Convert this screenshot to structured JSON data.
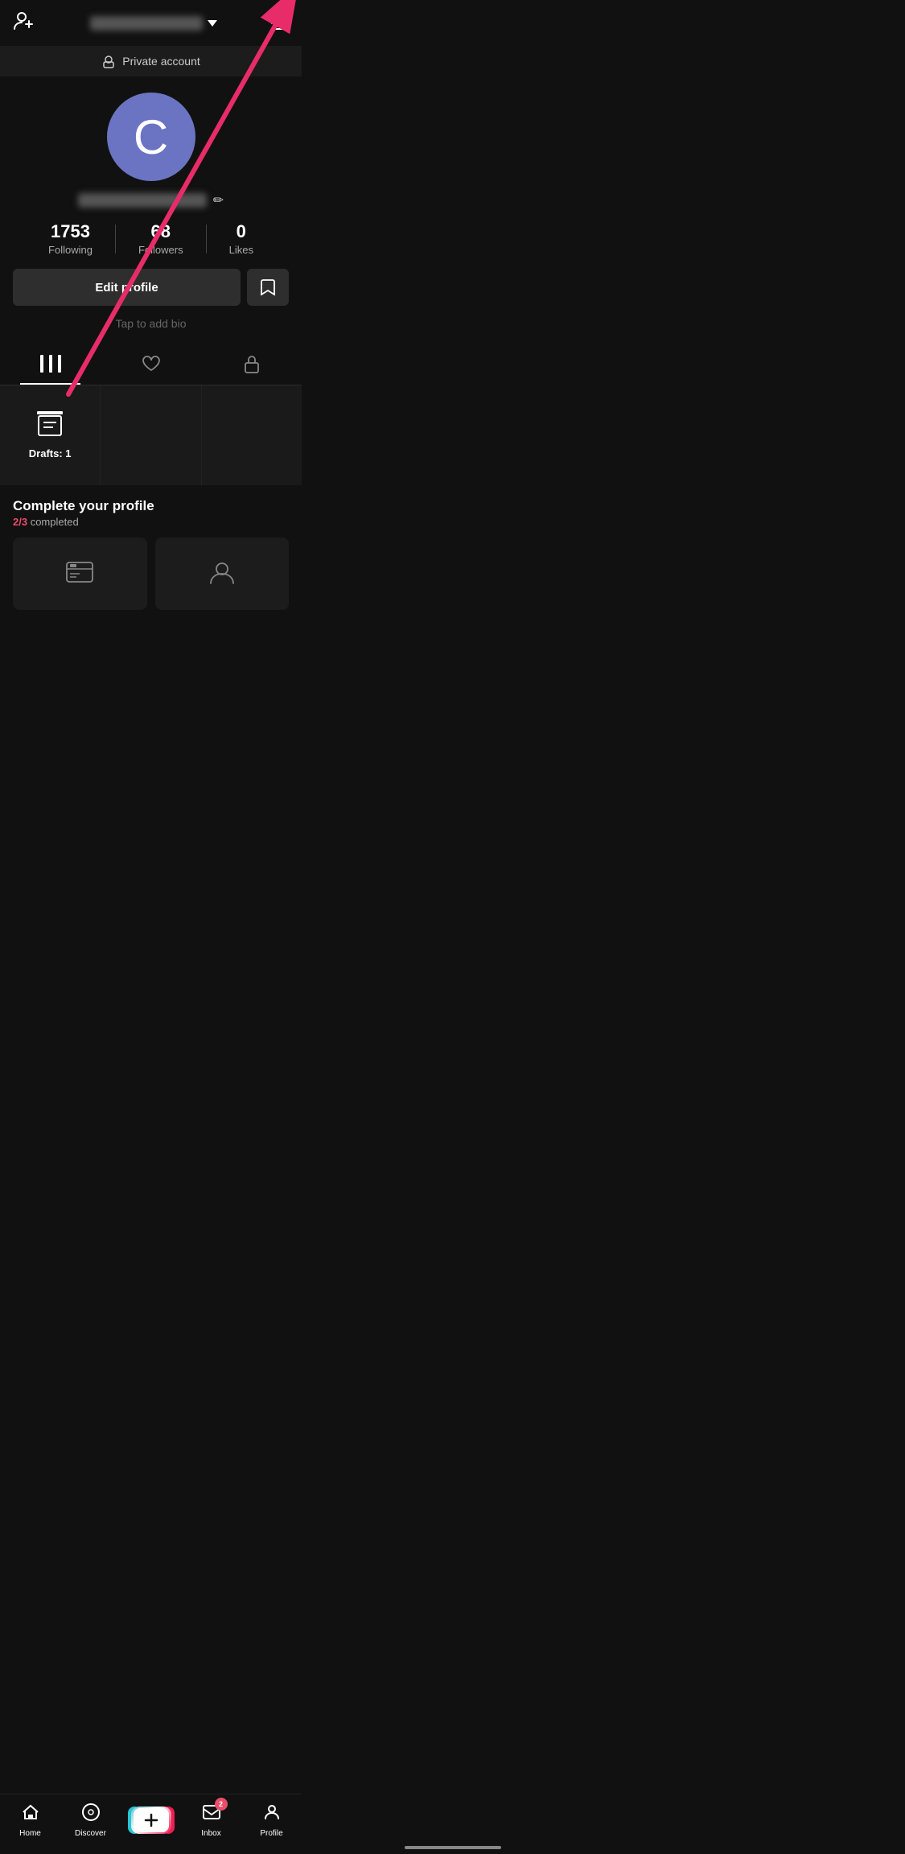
{
  "header": {
    "username_placeholder": "username blurred",
    "hamburger_label": "Menu",
    "add_user_label": "Add user"
  },
  "private_banner": {
    "text": "Private account",
    "icon": "🔒"
  },
  "profile": {
    "avatar_letter": "C",
    "avatar_bg": "#6b74c2",
    "name_placeholder": "name blurred",
    "edit_icon": "✏",
    "stats": {
      "following": {
        "value": "1753",
        "label": "Following"
      },
      "followers": {
        "value": "68",
        "label": "Followers"
      },
      "likes": {
        "value": "0",
        "label": "Likes"
      }
    },
    "edit_profile_label": "Edit profile",
    "bookmark_icon": "🔖",
    "bio_placeholder": "Tap to add bio",
    "tabs": [
      {
        "id": "grid",
        "icon": "⊞",
        "active": true
      },
      {
        "id": "liked",
        "icon": "♡",
        "active": false
      },
      {
        "id": "private",
        "icon": "🔒",
        "active": false
      }
    ]
  },
  "content": {
    "drafts_label": "Drafts: 1",
    "drafts_icon": "▬"
  },
  "complete_profile": {
    "title": "Complete your profile",
    "fraction": "2/3",
    "done_text": "completed"
  },
  "bottom_nav": {
    "items": [
      {
        "id": "home",
        "icon": "🏠",
        "label": "Home"
      },
      {
        "id": "discover",
        "icon": "◎",
        "label": "Discover"
      },
      {
        "id": "create",
        "icon": "+",
        "label": ""
      },
      {
        "id": "inbox",
        "icon": "💬",
        "label": "Inbox",
        "badge": "2"
      },
      {
        "id": "profile",
        "icon": "👤",
        "label": "Profile"
      }
    ]
  },
  "arrow": {
    "color": "#e82c6a"
  }
}
